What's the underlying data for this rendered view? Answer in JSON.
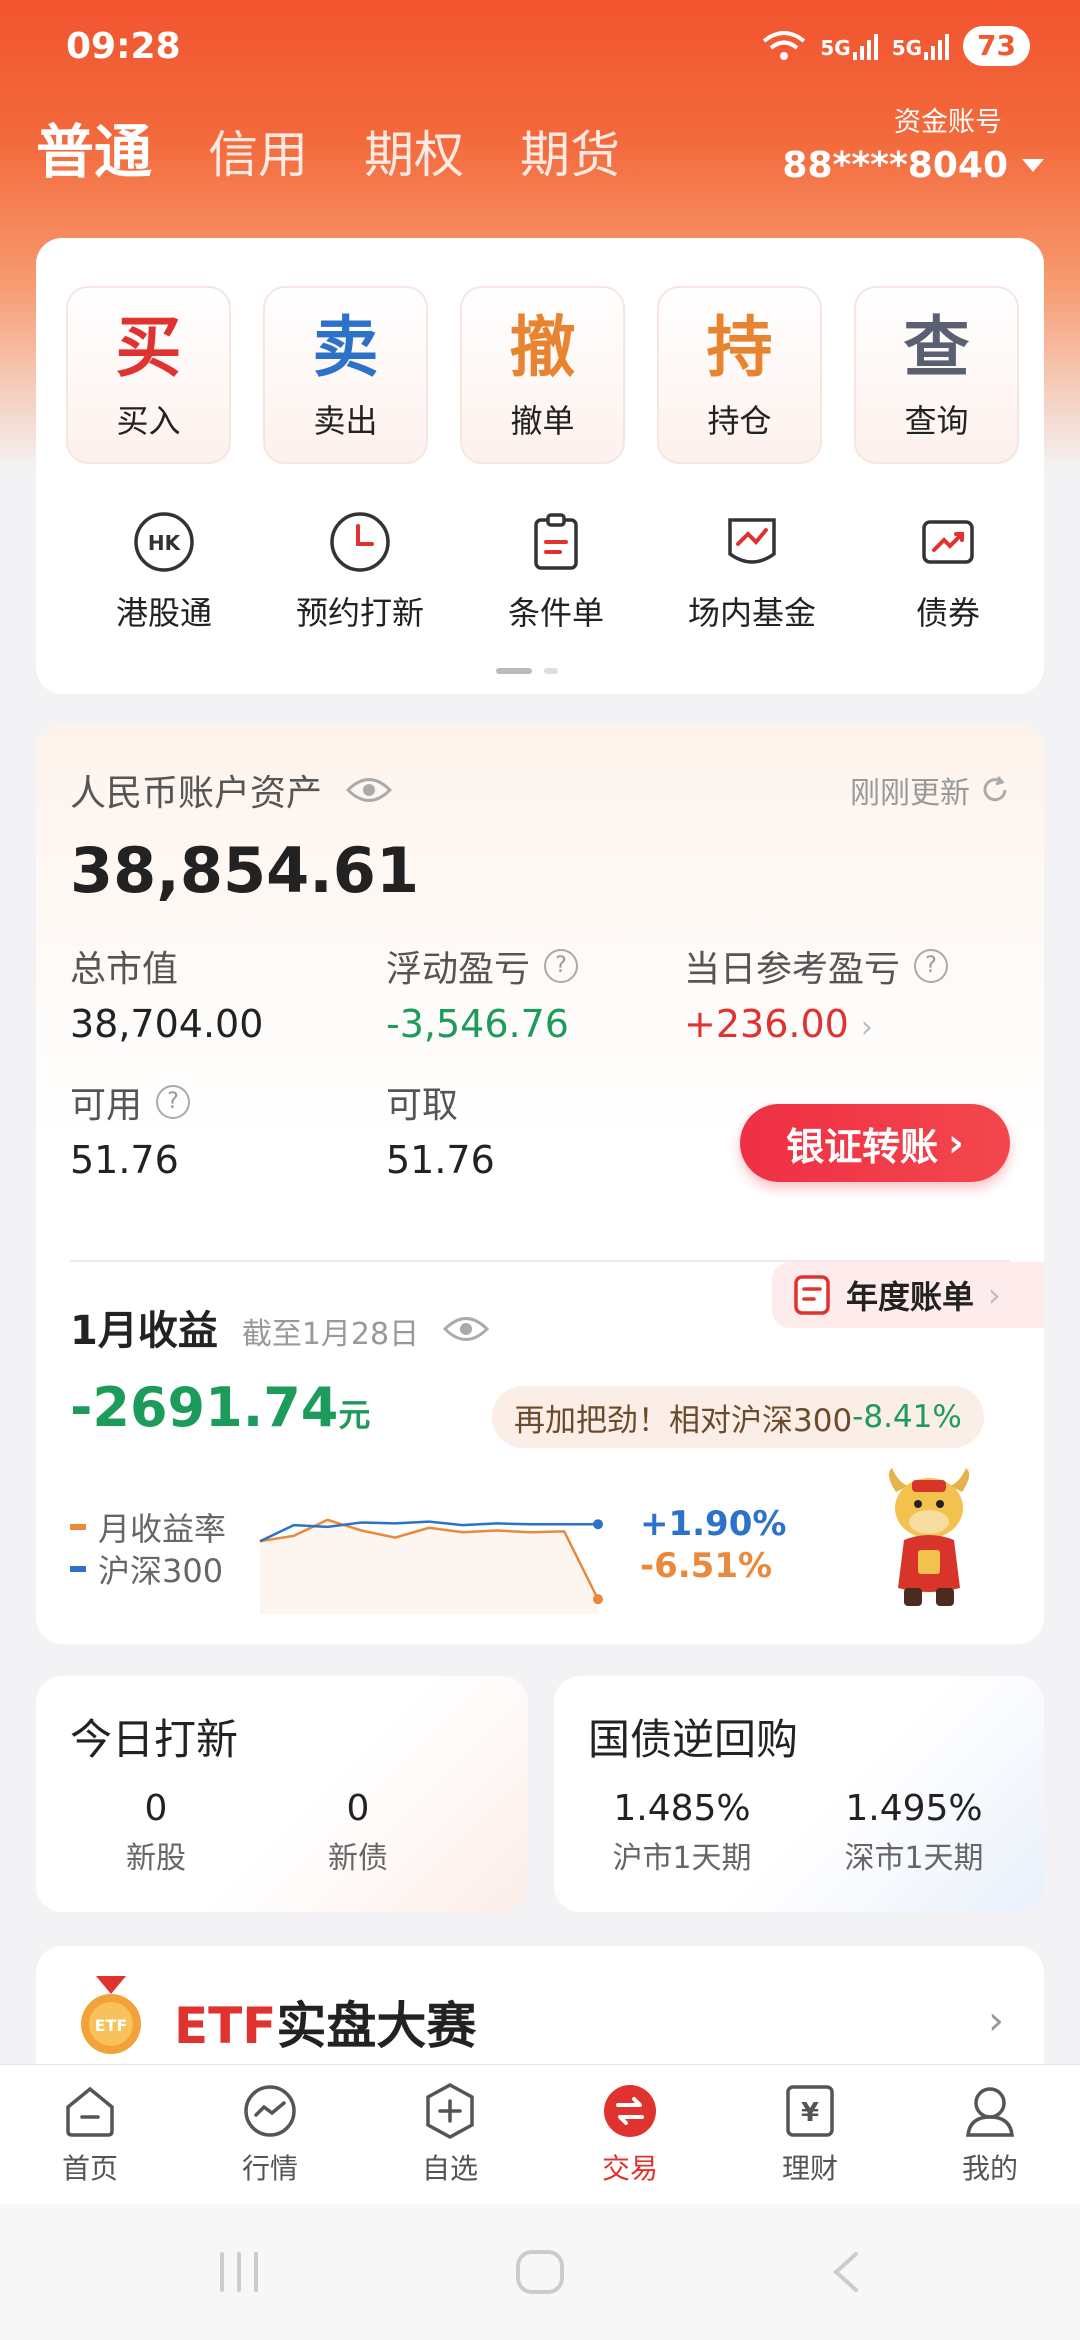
{
  "status": {
    "time": "09:28",
    "signal1": "5G",
    "signal2": "5G",
    "battery": "73"
  },
  "account_tabs": [
    {
      "label": "普通",
      "active": true
    },
    {
      "label": "信用",
      "active": false
    },
    {
      "label": "期权",
      "active": false
    },
    {
      "label": "期货",
      "active": false
    }
  ],
  "fund_account": {
    "label": "资金账号",
    "number": "88****8040"
  },
  "trade_actions": [
    {
      "glyph": "买",
      "label": "买入",
      "color": "#e0322f"
    },
    {
      "glyph": "卖",
      "label": "卖出",
      "color": "#2b72c8"
    },
    {
      "glyph": "撤",
      "label": "撤单",
      "color": "#e8832f"
    },
    {
      "glyph": "持",
      "label": "持仓",
      "color": "#e8832f"
    },
    {
      "glyph": "查",
      "label": "查询",
      "color": "#5a6072"
    }
  ],
  "quick_actions": [
    {
      "label": "港股通",
      "icon": "hk-connect-icon"
    },
    {
      "label": "预约打新",
      "icon": "clock-icon"
    },
    {
      "label": "条件单",
      "icon": "clipboard-icon"
    },
    {
      "label": "场内基金",
      "icon": "fund-chart-icon"
    },
    {
      "label": "债券",
      "icon": "bond-trend-icon"
    }
  ],
  "assets": {
    "title": "人民币账户资产",
    "refresh_text": "刚刚更新",
    "total": "38,854.61",
    "market_value_label": "总市值",
    "market_value": "38,704.00",
    "floating_pl_label": "浮动盈亏",
    "floating_pl": "-3,546.76",
    "daily_pl_label": "当日参考盈亏",
    "daily_pl": "+236.00",
    "available_label": "可用",
    "available": "51.76",
    "withdrawable_label": "可取",
    "withdrawable": "51.76",
    "transfer_button": "银证转账"
  },
  "monthly": {
    "annual_bill": "年度账单",
    "title": "1月收益",
    "as_of": "截至1月28日",
    "value": "-2691.74",
    "unit": "元",
    "encourage_text": "再加把劲！相对沪深300",
    "encourage_value": "-8.41%",
    "legend_rate": "月收益率",
    "legend_index": "沪深300",
    "index_pct": "+1.90%",
    "rate_pct": "-6.51%"
  },
  "chart_data": {
    "type": "line",
    "series": [
      {
        "name": "月收益率",
        "color": "#e8893c",
        "values": [
          0,
          0.6,
          2.4,
          1.2,
          0.4,
          1.5,
          1.0,
          1.2,
          1.0,
          1.1,
          -6.51
        ]
      },
      {
        "name": "沪深300",
        "color": "#2b72c8",
        "values": [
          0,
          1.8,
          1.6,
          2.1,
          2.0,
          2.2,
          1.8,
          2.0,
          1.9,
          1.9,
          1.9
        ]
      }
    ],
    "ylim": [
      -7.5,
      3.5
    ]
  },
  "ipo": {
    "title": "今日打新",
    "new_stock_count": "0",
    "new_stock_label": "新股",
    "new_bond_count": "0",
    "new_bond_label": "新债"
  },
  "repo": {
    "title": "国债逆回购",
    "sh_rate": "1.485%",
    "sh_label": "沪市1天期",
    "sz_rate": "1.495%",
    "sz_label": "深市1天期"
  },
  "etf": {
    "title_en": "ETF",
    "title_cn": "实盘大赛",
    "badge": "ETF"
  },
  "tabbar": [
    {
      "label": "首页",
      "icon": "home-icon",
      "active": false
    },
    {
      "label": "行情",
      "icon": "market-icon",
      "active": false
    },
    {
      "label": "自选",
      "icon": "watchlist-icon",
      "active": false
    },
    {
      "label": "交易",
      "icon": "trade-icon",
      "active": true
    },
    {
      "label": "理财",
      "icon": "wealth-icon",
      "active": false
    },
    {
      "label": "我的",
      "icon": "profile-icon",
      "active": false
    }
  ]
}
